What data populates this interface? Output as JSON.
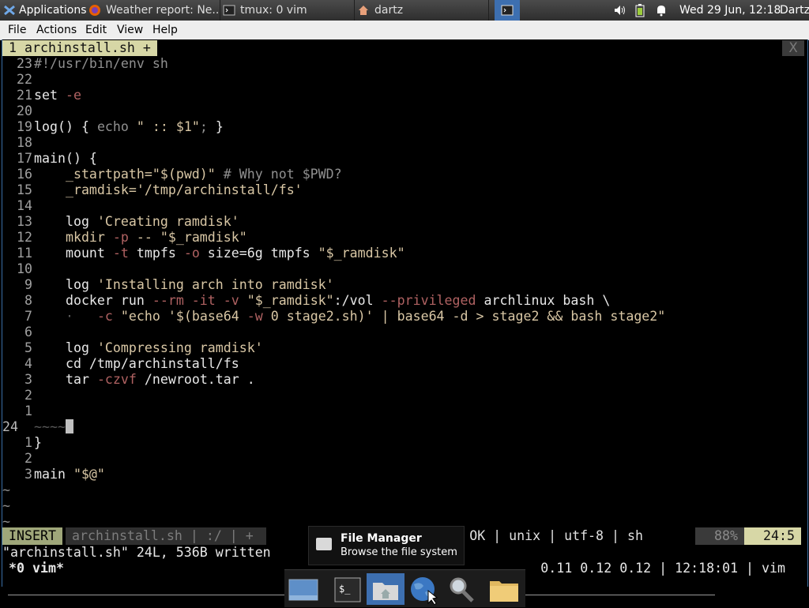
{
  "panel": {
    "applications_label": "Applications",
    "tasks": [
      {
        "label": "Weather report: Ne...",
        "icon": "firefox-icon"
      },
      {
        "label": "tmux: 0 vim",
        "icon": "terminal-icon"
      },
      {
        "label": "dartz",
        "icon": "home-folder-icon"
      }
    ],
    "clock": "Wed 29 Jun, 12:18",
    "user": "Dartz"
  },
  "menubar": {
    "items": [
      "File",
      "Actions",
      "Edit",
      "View",
      "Help"
    ]
  },
  "editor": {
    "tab_label": "1 archinstall.sh +",
    "close_label": "X",
    "lines": [
      {
        "num": "23",
        "tokens": [
          {
            "t": "#!/usr/bin/env sh",
            "c": "c"
          }
        ]
      },
      {
        "num": "22",
        "tokens": []
      },
      {
        "num": "21",
        "tokens": [
          {
            "t": "set ",
            "c": "n"
          },
          {
            "t": "-e",
            "c": "o"
          }
        ]
      },
      {
        "num": "20",
        "tokens": []
      },
      {
        "num": "19",
        "tokens": [
          {
            "t": "log() { ",
            "c": "n"
          },
          {
            "t": "echo ",
            "c": "c"
          },
          {
            "t": "\" :: $1\"",
            "c": "s"
          },
          {
            "t": "; ",
            "c": "c"
          },
          {
            "t": "}",
            "c": "n"
          }
        ]
      },
      {
        "num": "18",
        "tokens": []
      },
      {
        "num": "17",
        "tokens": [
          {
            "t": "main() {",
            "c": "n"
          }
        ]
      },
      {
        "num": "16",
        "tokens": [
          {
            "t": "    _startpath=",
            "c": "s"
          },
          {
            "t": "\"$(pwd)\"",
            "c": "s"
          },
          {
            "t": " # Why not $PWD?",
            "c": "c"
          }
        ]
      },
      {
        "num": "15",
        "tokens": [
          {
            "t": "    _ramdisk=",
            "c": "s"
          },
          {
            "t": "'/tmp/archinstall/fs'",
            "c": "s"
          }
        ]
      },
      {
        "num": "14",
        "tokens": []
      },
      {
        "num": "13",
        "tokens": [
          {
            "t": "    log ",
            "c": "n"
          },
          {
            "t": "'Creating ramdisk'",
            "c": "s"
          }
        ]
      },
      {
        "num": "12",
        "tokens": [
          {
            "t": "    mkdir ",
            "c": "s"
          },
          {
            "t": "-p",
            "c": "o"
          },
          {
            "t": " -- ",
            "c": "s"
          },
          {
            "t": "\"$_ramdisk\"",
            "c": "s"
          }
        ]
      },
      {
        "num": "11",
        "tokens": [
          {
            "t": "    mount ",
            "c": "n"
          },
          {
            "t": "-t",
            "c": "o"
          },
          {
            "t": " tmpfs ",
            "c": "n"
          },
          {
            "t": "-o",
            "c": "o"
          },
          {
            "t": " size=6g tmpfs ",
            "c": "n"
          },
          {
            "t": "\"$_ramdisk\"",
            "c": "s"
          }
        ]
      },
      {
        "num": "10",
        "tokens": []
      },
      {
        "num": "9",
        "tokens": [
          {
            "t": "    log ",
            "c": "n"
          },
          {
            "t": "'Installing arch into ramdisk'",
            "c": "s"
          }
        ]
      },
      {
        "num": "8",
        "tokens": [
          {
            "t": "    docker run ",
            "c": "n"
          },
          {
            "t": "--rm -it -v",
            "c": "o"
          },
          {
            "t": " ",
            "c": "n"
          },
          {
            "t": "\"$_ramdisk\"",
            "c": "s"
          },
          {
            "t": ":/vol ",
            "c": "n"
          },
          {
            "t": "--privileged",
            "c": "o"
          },
          {
            "t": " archlinux bash \\",
            "c": "n"
          }
        ]
      },
      {
        "num": "7",
        "tokens": [
          {
            "t": "    ·   ",
            "c": "d"
          },
          {
            "t": "-c",
            "c": "o"
          },
          {
            "t": " \"echo '",
            "c": "s"
          },
          {
            "t": "$(base64 ",
            "c": "s"
          },
          {
            "t": "-w",
            "c": "o"
          },
          {
            "t": " 0 stage2.sh",
            "c": "s"
          },
          {
            "t": ")' | base64 -d > stage2 && bash stage2\"",
            "c": "s"
          }
        ]
      },
      {
        "num": "6",
        "tokens": []
      },
      {
        "num": "5",
        "tokens": [
          {
            "t": "    log ",
            "c": "n"
          },
          {
            "t": "'Compressing ramdisk'",
            "c": "s"
          }
        ]
      },
      {
        "num": "4",
        "tokens": [
          {
            "t": "    cd /tmp/archinstall/fs",
            "c": "n"
          }
        ]
      },
      {
        "num": "3",
        "tokens": [
          {
            "t": "    tar ",
            "c": "n"
          },
          {
            "t": "-czvf",
            "c": "o"
          },
          {
            "t": " /newroot.tar .",
            "c": "n"
          }
        ]
      },
      {
        "num": "2",
        "tokens": []
      },
      {
        "num": "1",
        "tokens": []
      },
      {
        "num": "24",
        "current": true,
        "tokens": [
          {
            "t": "~~~~",
            "c": "d"
          }
        ],
        "cursor": true
      },
      {
        "num": "1",
        "tokens": [
          {
            "t": "}",
            "c": "n"
          }
        ]
      },
      {
        "num": "2",
        "tokens": []
      },
      {
        "num": "3",
        "tokens": [
          {
            "t": "main ",
            "c": "n"
          },
          {
            "t": "\"$@\"",
            "c": "s"
          }
        ]
      }
    ],
    "tildes": [
      "~",
      "~",
      "~"
    ],
    "status": {
      "mode": "INSERT",
      "file": "archinstall.sh | :/ | +",
      "info": "OK | unix | utf-8 | sh",
      "percent": "88%",
      "position": "24:5"
    },
    "message": "\"archinstall.sh\" 24L, 536B written",
    "tmux_left": "*0 vim*",
    "tmux_right": "0.11 0.12 0.12 | 12:18:01 | vim"
  },
  "tooltip": {
    "title": "File Manager",
    "subtitle": "Browse the file system"
  },
  "dock": {
    "items": [
      "show-desktop-icon",
      "terminal-icon",
      "home-folder-icon",
      "web-browser-icon",
      "search-icon",
      "files-folder-icon"
    ]
  },
  "colors": {
    "code_normal": "#e8e8e8",
    "code_comment": "#909090",
    "code_string": "#d9c7a5",
    "code_option": "#b06262",
    "mode_bg": "#9fa77a",
    "tab_bg": "#d7d7a6"
  }
}
